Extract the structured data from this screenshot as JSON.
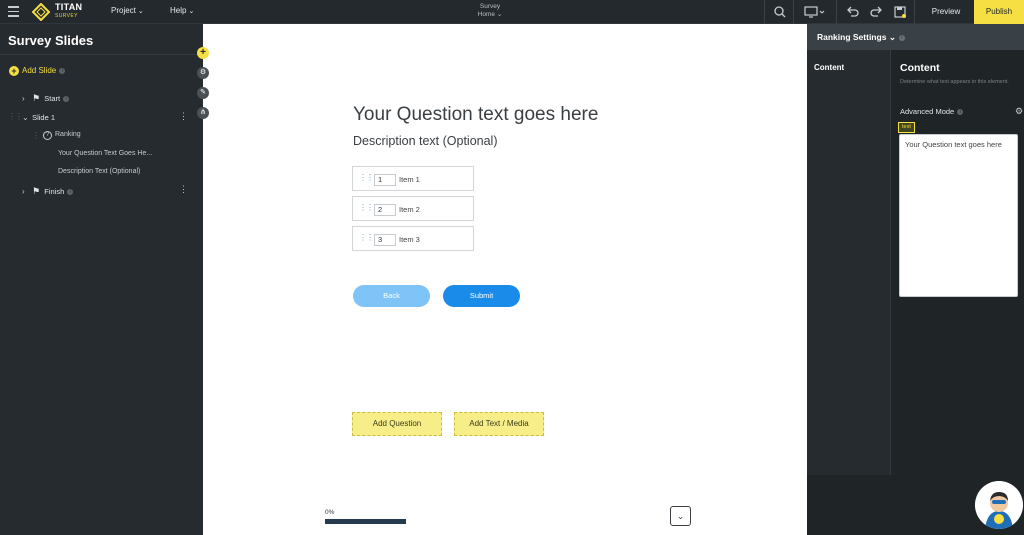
{
  "topbar": {
    "brand_name": "TITAN",
    "brand_sub": "SURVEY",
    "menus": [
      {
        "label": "Project"
      },
      {
        "label": "Help"
      }
    ],
    "center_title": "Survey",
    "center_page": "Home",
    "preview_label": "Preview",
    "publish_label": "Publish",
    "accent_color": "#f5df43"
  },
  "left_panel": {
    "title": "Survey Slides",
    "add_slide_label": "Add Slide",
    "tree": {
      "start": "Start",
      "slide1": "Slide 1",
      "ranking": "Ranking",
      "question_text": "Your Question Text Goes He...",
      "description_text": "Description Text (Optional)",
      "finish": "Finish"
    }
  },
  "canvas": {
    "question_title": "Your Question text goes here",
    "description": "Description text (Optional)",
    "items": [
      {
        "rank": "1",
        "label": "Item 1"
      },
      {
        "rank": "2",
        "label": "Item 2"
      },
      {
        "rank": "3",
        "label": "Item 3"
      }
    ],
    "back_label": "Back",
    "submit_label": "Submit",
    "add_question_label": "Add Question",
    "add_text_media_label": "Add Text / Media",
    "progress_label": "0%",
    "progress_value": 0
  },
  "right_panel": {
    "header_title": "Ranking Settings",
    "nav_content": "Content",
    "section_title": "Content",
    "section_help": "Determine what text appears in this element.",
    "advanced_mode_label": "Advanced Mode",
    "text_tag": "text",
    "textarea_value": "Your Question text goes here"
  }
}
